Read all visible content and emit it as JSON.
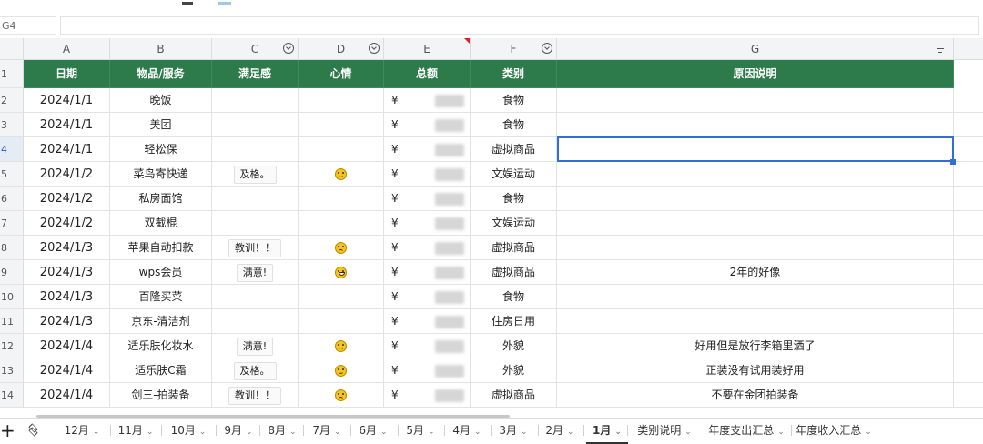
{
  "namebox": "G4",
  "columns": [
    {
      "letter": "A",
      "filter": false
    },
    {
      "letter": "B",
      "filter": false
    },
    {
      "letter": "C",
      "filter": true
    },
    {
      "letter": "D",
      "filter": true
    },
    {
      "letter": "E",
      "filter": false
    },
    {
      "letter": "F",
      "filter": true
    },
    {
      "letter": "G",
      "filter": false
    }
  ],
  "header_labels": [
    "日期",
    "物品/服务",
    "满足感",
    "心情",
    "总额",
    "类别",
    "原因说明"
  ],
  "rows": [
    {
      "num": "2",
      "date": "2024/1/1",
      "item": "晚饭",
      "satisfaction": "",
      "mood": "",
      "amount": "¥",
      "category": "食物",
      "reason": ""
    },
    {
      "num": "3",
      "date": "2024/1/1",
      "item": "美团",
      "satisfaction": "",
      "mood": "",
      "amount": "¥",
      "category": "食物",
      "reason": ""
    },
    {
      "num": "4",
      "date": "2024/1/1",
      "item": "轻松保",
      "satisfaction": "",
      "mood": "",
      "amount": "¥",
      "category": "虚拟商品",
      "reason": ""
    },
    {
      "num": "5",
      "date": "2024/1/2",
      "item": "菜鸟寄快递",
      "satisfaction": "及格。",
      "mood": "smile",
      "amount": "¥",
      "category": "文娱运动",
      "reason": ""
    },
    {
      "num": "6",
      "date": "2024/1/2",
      "item": "私房面馆",
      "satisfaction": "",
      "mood": "",
      "amount": "¥",
      "category": "食物",
      "reason": ""
    },
    {
      "num": "7",
      "date": "2024/1/2",
      "item": "双截棍",
      "satisfaction": "",
      "mood": "",
      "amount": "¥",
      "category": "文娱运动",
      "reason": ""
    },
    {
      "num": "8",
      "date": "2024/1/3",
      "item": "苹果自动扣款",
      "satisfaction": "教训！！",
      "mood": "angry",
      "amount": "¥",
      "category": "虚拟商品",
      "reason": ""
    },
    {
      "num": "9",
      "date": "2024/1/3",
      "item": "wps会员",
      "satisfaction": "满意!",
      "mood": "grin",
      "amount": "¥",
      "category": "虚拟商品",
      "reason": "2年的好像"
    },
    {
      "num": "10",
      "date": "2024/1/3",
      "item": "百隆买菜",
      "satisfaction": "",
      "mood": "",
      "amount": "¥",
      "category": "食物",
      "reason": ""
    },
    {
      "num": "11",
      "date": "2024/1/3",
      "item": "京东-清洁剂",
      "satisfaction": "",
      "mood": "",
      "amount": "¥",
      "category": "住房日用",
      "reason": ""
    },
    {
      "num": "12",
      "date": "2024/1/4",
      "item": "适乐肤化妆水",
      "satisfaction": "满意!",
      "mood": "angry",
      "amount": "¥",
      "category": "外貌",
      "reason": "好用但是放行李箱里洒了"
    },
    {
      "num": "13",
      "date": "2024/1/4",
      "item": "适乐肤C霜",
      "satisfaction": "及格。",
      "mood": "smile",
      "amount": "¥",
      "category": "外貌",
      "reason": "正装没有试用装好用"
    },
    {
      "num": "14",
      "date": "2024/1/4",
      "item": "剑三-拍装备",
      "satisfaction": "教训！！",
      "mood": "angry",
      "amount": "¥",
      "category": "虚拟商品",
      "reason": "不要在金团拍装备"
    }
  ],
  "sheet_tabs": [
    "12月",
    "11月",
    "10月",
    "9月",
    "8月",
    "7月",
    "6月",
    "5月",
    "4月",
    "3月",
    "2月",
    "1月",
    "类别说明",
    "年度支出汇总",
    "年度收入汇总"
  ],
  "active_tab": "1月",
  "colors": {
    "header_bg": "#2d7a4a",
    "selection": "#2f6fd6"
  }
}
